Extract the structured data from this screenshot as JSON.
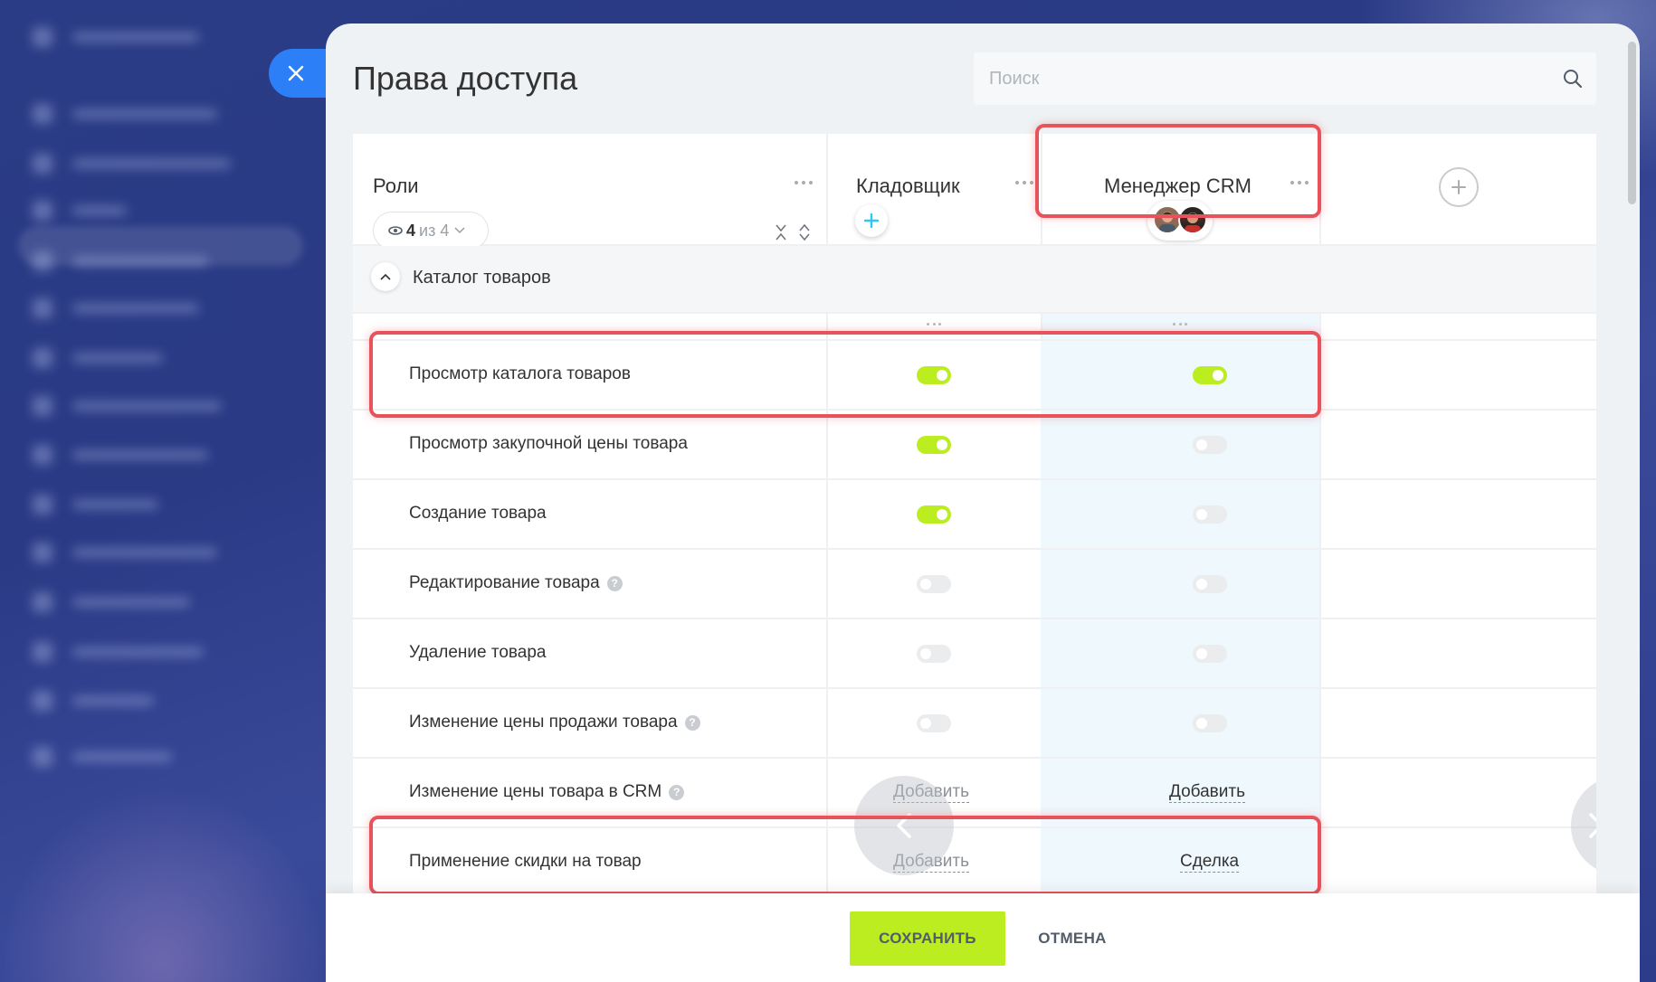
{
  "page": {
    "title": "Права доступа",
    "search_placeholder": "Поиск"
  },
  "roles_header": {
    "label": "Роли",
    "visible_count": "4",
    "of_text": "из 4"
  },
  "roles": [
    {
      "name": "Кладовщик"
    },
    {
      "name": "Менеджер CRM"
    }
  ],
  "section": {
    "title": "Каталог товаров",
    "expanded": true
  },
  "permissions": [
    {
      "label": "Просмотр каталога товаров",
      "help": false,
      "kladovshik": "on",
      "manager": "on"
    },
    {
      "label": "Просмотр закупочной цены товара",
      "help": false,
      "kladovshik": "on",
      "manager": "off"
    },
    {
      "label": "Создание товара",
      "help": false,
      "kladovshik": "on",
      "manager": "off"
    },
    {
      "label": "Редактирование товара",
      "help": true,
      "kladovshik": "off",
      "manager": "off"
    },
    {
      "label": "Удаление товара",
      "help": false,
      "kladovshik": "off",
      "manager": "off"
    },
    {
      "label": "Изменение цены продажи товара",
      "help": true,
      "kladovshik": "off",
      "manager": "off"
    },
    {
      "label": "Изменение цены товара в CRM",
      "help": true,
      "kladovshik": "Добавить",
      "manager": "Добавить"
    },
    {
      "label": "Применение скидки на товар",
      "help": false,
      "kladovshik": "Добавить",
      "manager": "Сделка"
    }
  ],
  "footer": {
    "save_label": "СОХРАНИТЬ",
    "cancel_label": "ОТМЕНА"
  },
  "colors": {
    "accent_blue": "#2d7ff7",
    "toggle_on": "#bbed21",
    "toggle_off": "#eaecee",
    "highlight": "#e8525b",
    "save_bg": "#bbed21",
    "crm_column_bg": "#eef8fd"
  },
  "icons": {
    "close": "close-icon",
    "search": "search-icon",
    "eye": "eye-icon",
    "chevron_down": "chevron-down-icon",
    "collapse": "collapse-icon",
    "expand": "expand-icon",
    "plus": "plus-icon",
    "chevron_up": "chevron-up-icon",
    "arrow_left": "arrow-left-icon",
    "arrow_right": "arrow-right-icon",
    "help": "help-icon",
    "more": "more-dots-icon"
  }
}
